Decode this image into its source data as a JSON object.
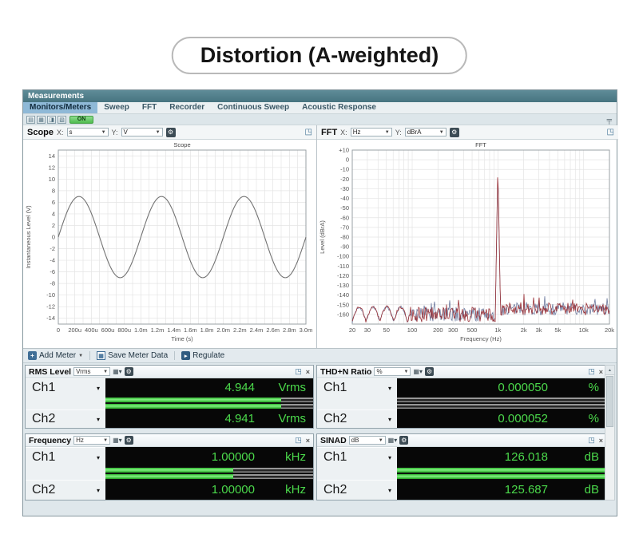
{
  "page": {
    "title": "Distortion (A-weighted)"
  },
  "window": {
    "title": "Measurements",
    "tabs": [
      {
        "label": "Monitors/Meters",
        "selected": true
      },
      {
        "label": "Sweep",
        "selected": false
      },
      {
        "label": "FFT",
        "selected": false
      },
      {
        "label": "Recorder",
        "selected": false
      },
      {
        "label": "Continuous Sweep",
        "selected": false
      },
      {
        "label": "Acoustic Response",
        "selected": false
      }
    ],
    "toolbar": {
      "icons": [
        {
          "name": "layout-single-icon",
          "glyph": "▤"
        },
        {
          "name": "layout-grid-icon",
          "glyph": "▦"
        },
        {
          "name": "layout-split-icon",
          "glyph": "◨"
        },
        {
          "name": "layout-panes-icon",
          "glyph": "▧"
        }
      ],
      "on_label": "ON",
      "pin_glyph": "╤"
    }
  },
  "scope_panel": {
    "name": "Scope",
    "x_label": "X:",
    "x_unit": "s",
    "y_label": "Y:",
    "y_unit": "V"
  },
  "fft_panel": {
    "name": "FFT",
    "x_label": "X:",
    "x_unit": "Hz",
    "y_label": "Y:",
    "y_unit": "dBrA"
  },
  "chart_data": [
    {
      "type": "line",
      "title": "Scope",
      "xlabel": "Time (s)",
      "ylabel": "Instantaneous Level (V)",
      "xlim_s": [
        0,
        0.003
      ],
      "ylim": [
        -15,
        15
      ],
      "x_tick_labels": [
        "0",
        "200u",
        "400u",
        "600u",
        "800u",
        "1.0m",
        "1.2m",
        "1.4m",
        "1.6m",
        "1.8m",
        "2.0m",
        "2.2m",
        "2.4m",
        "2.6m",
        "2.8m",
        "3.0m"
      ],
      "y_ticks": [
        14,
        12,
        10,
        8,
        6,
        4,
        2,
        0,
        -2,
        -4,
        -6,
        -8,
        -10,
        -12,
        -14
      ],
      "grid": true,
      "series": [
        {
          "name": "Instantaneous Level",
          "waveform": "sine",
          "amplitude_v": 7.0,
          "frequency_hz": 1000,
          "phase_deg": 0,
          "cycles_shown": 3,
          "color": "#737373"
        }
      ]
    },
    {
      "type": "line",
      "title": "FFT",
      "xlabel": "Frequency (Hz)",
      "ylabel": "Level (dBrA)",
      "xscale": "log",
      "xlim_hz": [
        20,
        20000
      ],
      "ylim": [
        -170,
        10
      ],
      "x_tick_values": [
        20,
        30,
        50,
        100,
        200,
        300,
        500,
        1000,
        2000,
        3000,
        5000,
        10000,
        20000
      ],
      "x_tick_labels": [
        "20",
        "30",
        "50",
        "100",
        "200",
        "300",
        "500",
        "1k",
        "2k",
        "3k",
        "5k",
        "10k",
        "20k"
      ],
      "y_tick_labels": [
        "+10",
        "0",
        "-10",
        "-20",
        "-30",
        "-40",
        "-50",
        "-60",
        "-70",
        "-80",
        "-90",
        "-100",
        "-110",
        "-120",
        "-130",
        "-140",
        "-150",
        "-160"
      ],
      "grid": true,
      "fundamental": {
        "frequency_hz": 1000,
        "level_dbra": -1
      },
      "noise_floor_dbra": -160,
      "harmonics": [
        {
          "frequency_hz": 2000,
          "level_dbra": -139
        },
        {
          "frequency_hz": 3000,
          "level_dbra": -144
        },
        {
          "frequency_hz": 5000,
          "level_dbra": -150
        },
        {
          "frequency_hz": 7000,
          "level_dbra": -152
        }
      ],
      "series": [
        {
          "name": "Ch1",
          "color": "#9a3036"
        },
        {
          "name": "Ch2",
          "color": "#5e6d95"
        }
      ]
    }
  ],
  "meter_toolbar": {
    "add_meter": "Add Meter",
    "save_meter_data": "Save Meter Data",
    "regulate": "Regulate"
  },
  "meters": {
    "rms": {
      "title": "RMS Level",
      "unit_selector": "Vrms",
      "channels": [
        {
          "name": "Ch1",
          "value": "4.944",
          "unit": "Vrms",
          "bar_fill": 0.845
        },
        {
          "name": "Ch2",
          "value": "4.941",
          "unit": "Vrms",
          "bar_fill": 0.845
        }
      ]
    },
    "thdn": {
      "title": "THD+N Ratio",
      "unit_selector": "%",
      "channels": [
        {
          "name": "Ch1",
          "value": "0.000050",
          "unit": "%",
          "bar_fill": 0
        },
        {
          "name": "Ch2",
          "value": "0.000052",
          "unit": "%",
          "bar_fill": 0
        }
      ]
    },
    "freq": {
      "title": "Frequency",
      "unit_selector": "Hz",
      "channels": [
        {
          "name": "Ch1",
          "value": "1.00000",
          "unit": "kHz",
          "bar_fill": 0.615
        },
        {
          "name": "Ch2",
          "value": "1.00000",
          "unit": "kHz",
          "bar_fill": 0.615
        }
      ]
    },
    "sinad": {
      "title": "SINAD",
      "unit_selector": "dB",
      "channels": [
        {
          "name": "Ch1",
          "value": "126.018",
          "unit": "dB",
          "bar_fill": 1
        },
        {
          "name": "Ch2",
          "value": "125.687",
          "unit": "dB",
          "bar_fill": 1
        }
      ]
    }
  }
}
